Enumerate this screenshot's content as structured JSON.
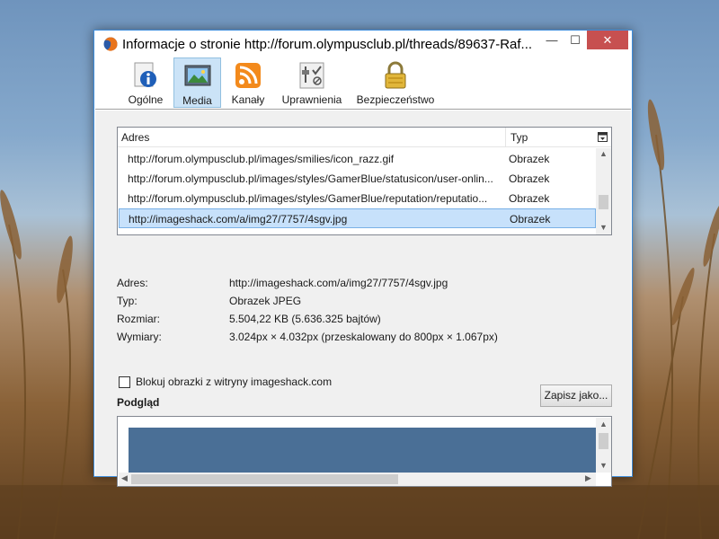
{
  "window": {
    "title": "Informacje o stronie http://forum.olympusclub.pl/threads/89637-Raf...",
    "minimize_glyph": "—",
    "maximize_glyph": "☐",
    "close_glyph": "✕"
  },
  "tabs": [
    {
      "label": "Ogólne",
      "icon": "info-icon",
      "active": false
    },
    {
      "label": "Media",
      "icon": "media-icon",
      "active": true
    },
    {
      "label": "Kanały",
      "icon": "rss-icon",
      "active": false
    },
    {
      "label": "Uprawnienia",
      "icon": "permissions-icon",
      "active": false
    },
    {
      "label": "Bezpieczeństwo",
      "icon": "lock-icon",
      "active": false
    }
  ],
  "media_list": {
    "headers": {
      "address": "Adres",
      "type": "Typ"
    },
    "rows": [
      {
        "address": "http://forum.olympusclub.pl/images/smilies/icon_razz.gif",
        "type": "Obrazek"
      },
      {
        "address": "http://forum.olympusclub.pl/images/styles/GamerBlue/statusicon/user-onlin...",
        "type": "Obrazek"
      },
      {
        "address": "http://forum.olympusclub.pl/images/styles/GamerBlue/reputation/reputatio...",
        "type": "Obrazek"
      },
      {
        "address": "http://imageshack.com/a/img27/7757/4sgv.jpg",
        "type": "Obrazek",
        "selected": true
      }
    ]
  },
  "properties": {
    "address_label": "Adres:",
    "address_value": "http://imageshack.com/a/img27/7757/4sgv.jpg",
    "type_label": "Typ:",
    "type_value": "Obrazek JPEG",
    "size_label": "Rozmiar:",
    "size_value": "5.504,22 KB (5.636.325 bajtów)",
    "dimensions_label": "Wymiary:",
    "dimensions_value": "3.024px × 4.032px (przeskalowany do 800px × 1.067px)"
  },
  "block_images": {
    "label": "Blokuj obrazki z witryny imageshack.com",
    "checked": false
  },
  "save_button": "Zapisz jako...",
  "preview_label": "Podgląd",
  "colors": {
    "accent": "#3f8ddb",
    "selection": "#c7e1fb",
    "close": "#c75050",
    "preview_image": "#4a6f96"
  }
}
